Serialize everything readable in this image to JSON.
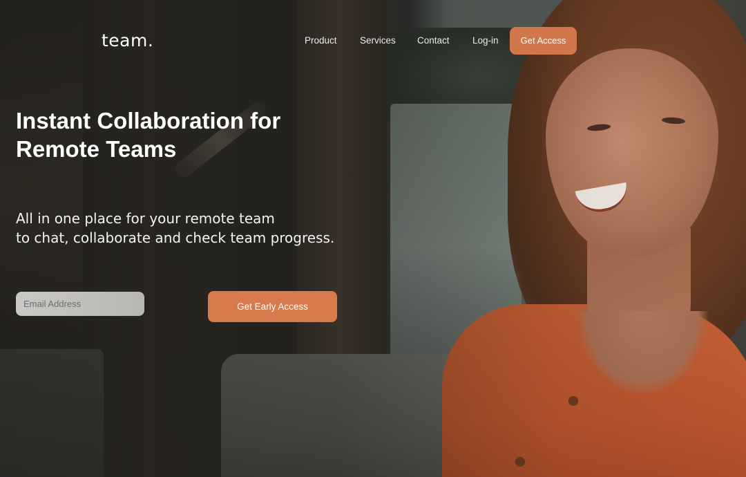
{
  "brand": {
    "logo_text": "team."
  },
  "nav": {
    "links": [
      {
        "label": "Product"
      },
      {
        "label": "Services"
      },
      {
        "label": "Contact"
      },
      {
        "label": "Log-in"
      }
    ],
    "cta_label": "Get Access"
  },
  "hero": {
    "title": "Instant Collaboration for Remote Teams",
    "subtitle_lines": [
      "All in one place for your remote team",
      "to chat, collaborate and check team progress."
    ],
    "email_placeholder": "Email Address",
    "email_value": "",
    "cta_label": "Get Early Access"
  },
  "colors": {
    "accent": "#d87a4b",
    "text": "#ffffff",
    "input_bg": "#c4c3c0"
  }
}
